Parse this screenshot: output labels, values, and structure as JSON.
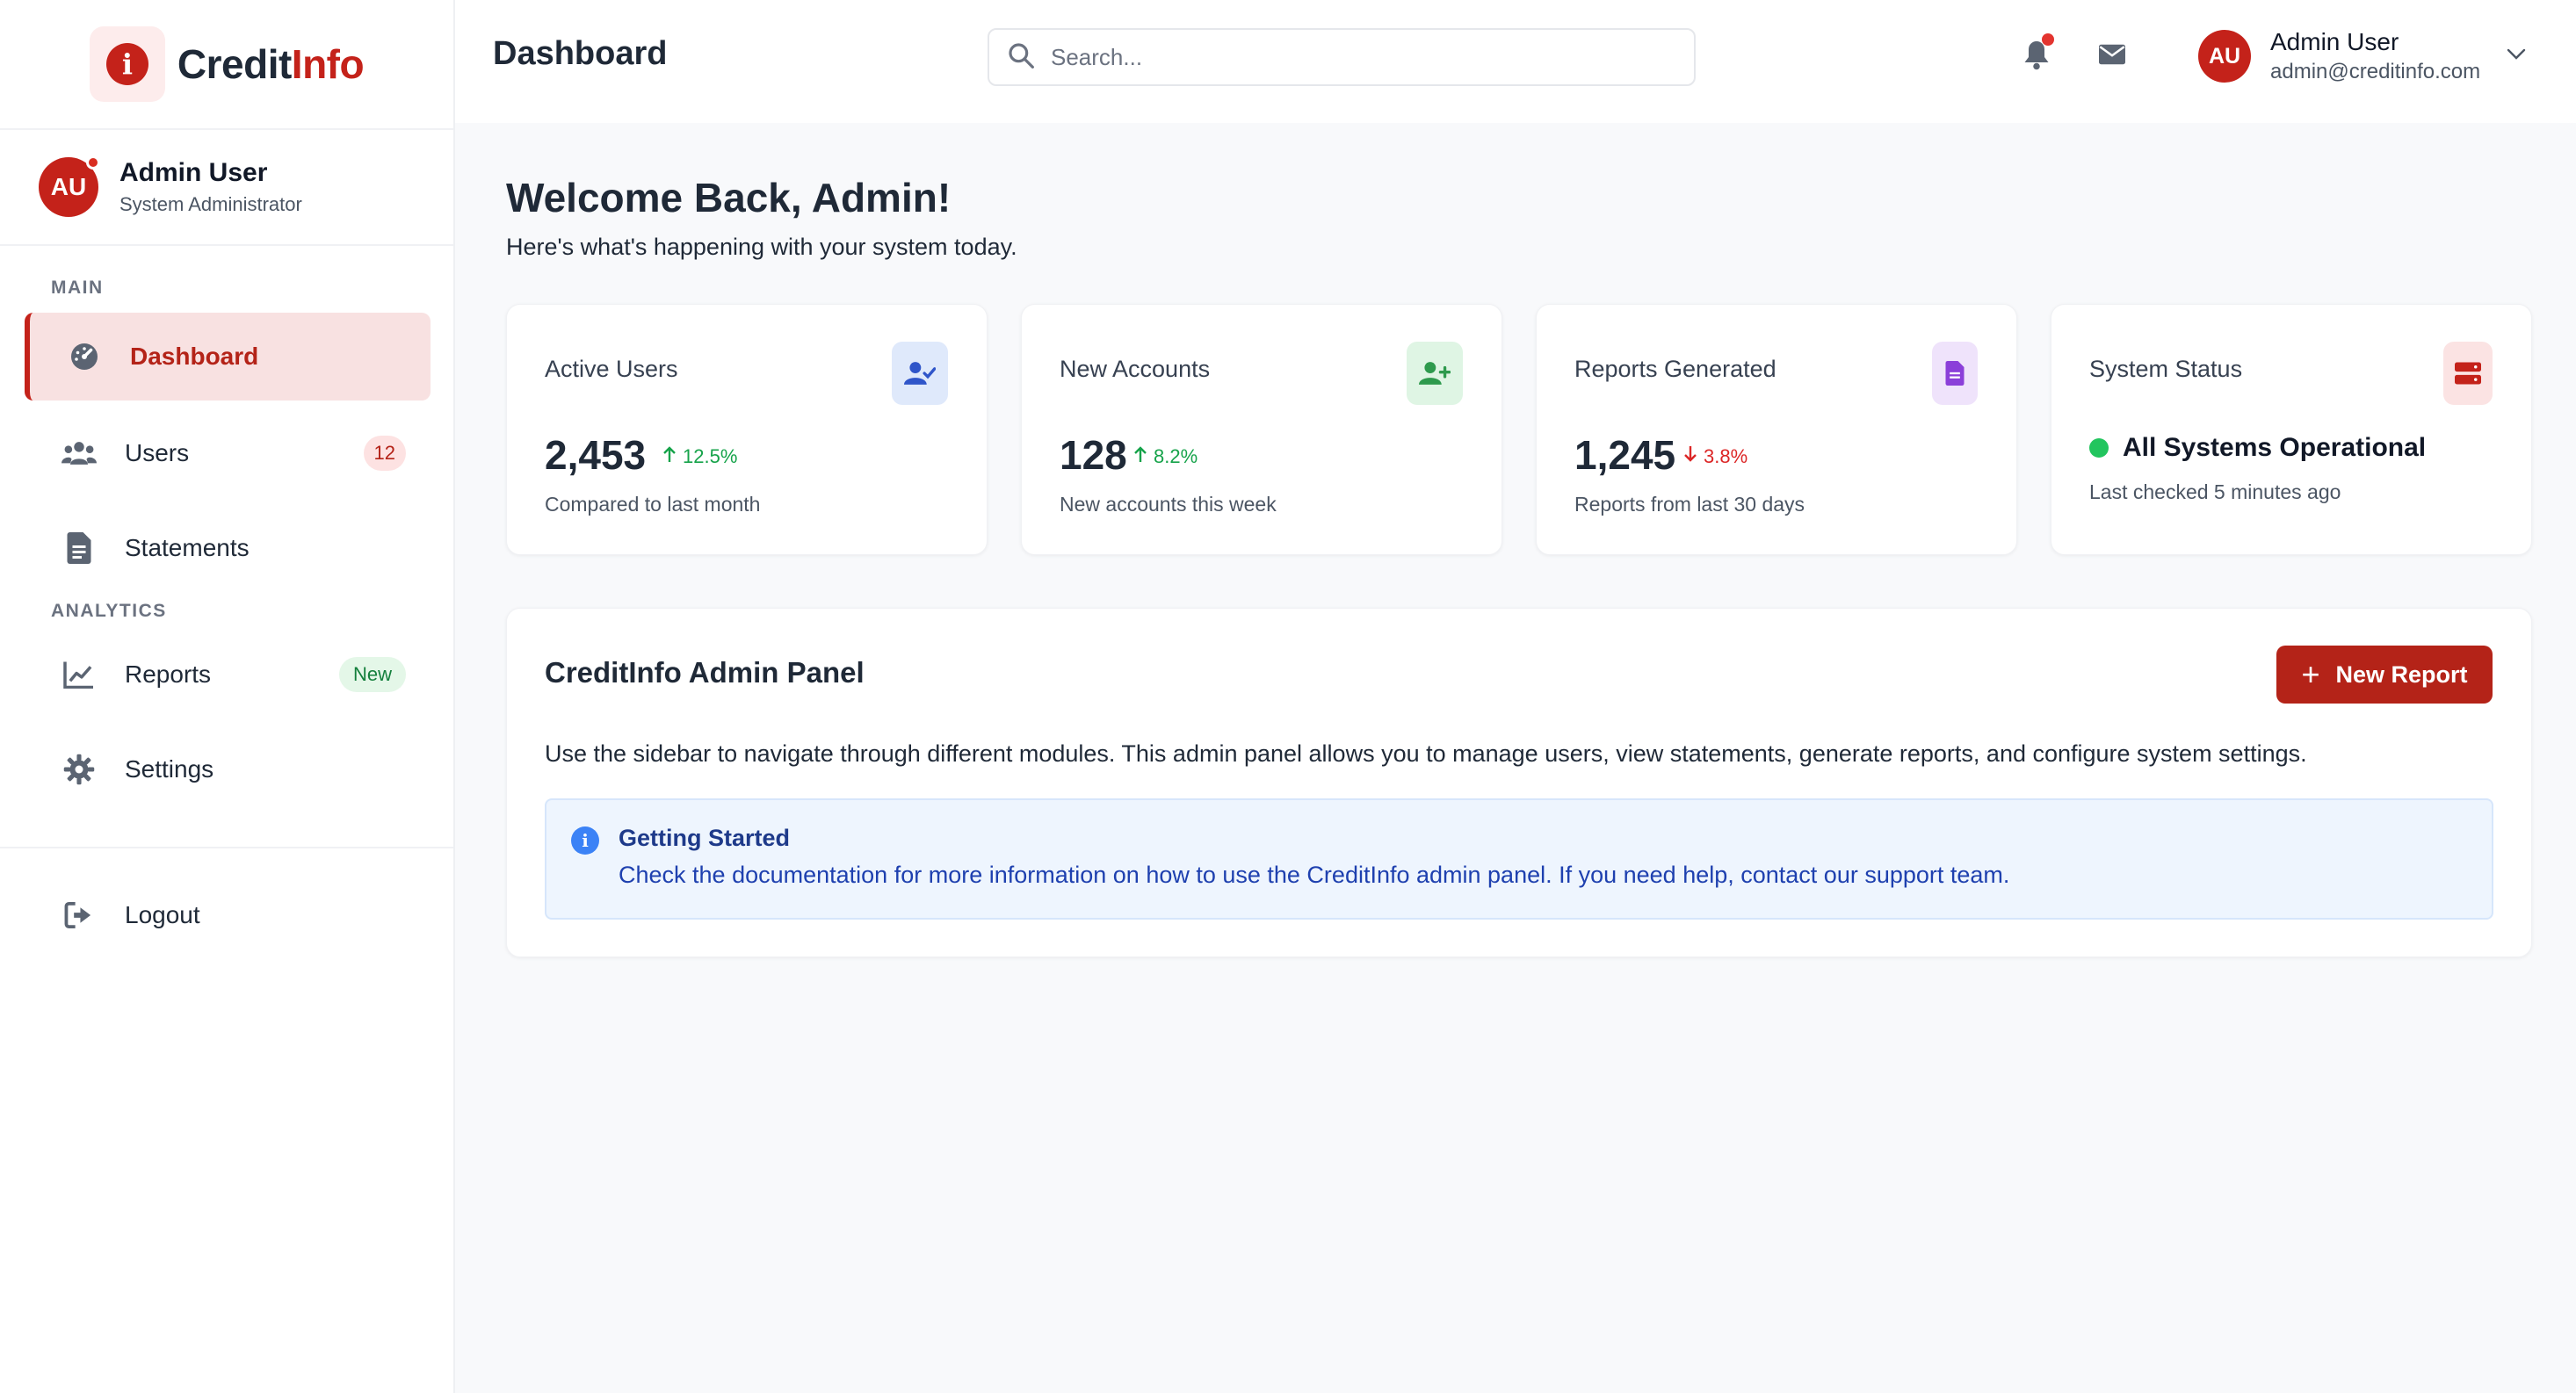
{
  "brand": {
    "name_part1": "Credit",
    "name_part2": "Info",
    "logo_glyph": "i",
    "accent": "#c4221a"
  },
  "sidebar": {
    "profile": {
      "initials": "AU",
      "name": "Admin User",
      "role": "System Administrator"
    },
    "sections": {
      "main": "MAIN",
      "analytics": "ANALYTICS"
    },
    "items": [
      {
        "label": "Dashboard",
        "icon": "gauge-icon",
        "active": true
      },
      {
        "label": "Users",
        "icon": "users-icon",
        "badge": "12"
      },
      {
        "label": "Statements",
        "icon": "document-icon"
      },
      {
        "label": "Reports",
        "icon": "line-chart-icon",
        "badge": "New"
      },
      {
        "label": "Settings",
        "icon": "gear-icon"
      },
      {
        "label": "Logout",
        "icon": "logout-icon"
      }
    ]
  },
  "header": {
    "title": "Dashboard",
    "search_placeholder": "Search...",
    "user": {
      "initials": "AU",
      "name": "Admin User",
      "email": "admin@creditinfo.com"
    }
  },
  "welcome": {
    "title": "Welcome Back, Admin!",
    "subtitle": "Here's what's happening with your system today."
  },
  "stats": [
    {
      "title": "Active Users",
      "value": "2,453",
      "change": "12.5%",
      "direction": "up",
      "foot": "Compared to last month",
      "icon": "user-check-icon",
      "icon_bg": "#dfe9fb",
      "icon_color": "#2f55c9"
    },
    {
      "title": "New Accounts",
      "value": "128",
      "change": "8.2%",
      "direction": "up",
      "foot": "New accounts this week",
      "icon": "user-plus-icon",
      "icon_bg": "#dff5e4",
      "icon_color": "#2e9a4d"
    },
    {
      "title": "Reports Generated",
      "value": "1,245",
      "change": "3.8%",
      "direction": "down",
      "foot": "Reports from last 30 days",
      "icon": "file-icon",
      "icon_bg": "#efe3fb",
      "icon_color": "#8b3fd9"
    },
    {
      "title": "System Status",
      "status": "All Systems Operational",
      "foot": "Last checked 5 minutes ago",
      "icon": "server-icon",
      "icon_bg": "#fbe3e3",
      "icon_color": "#c4221a"
    }
  ],
  "panel": {
    "title": "CreditInfo Admin Panel",
    "button": "New Report",
    "description": "Use the sidebar to navigate through different modules. This admin panel allows you to manage users, view statements, generate reports, and configure system settings.",
    "info": {
      "title": "Getting Started",
      "text": "Check the documentation for more information on how to use the CreditInfo admin panel. If you need help, contact our support team."
    }
  }
}
